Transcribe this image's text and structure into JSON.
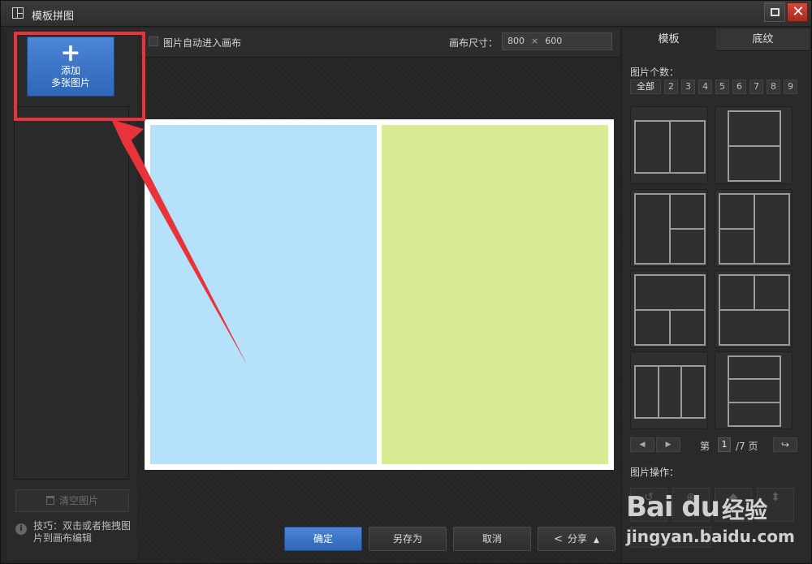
{
  "window": {
    "title": "模板拼图"
  },
  "left": {
    "add_plus": "+",
    "add_line1": "添加",
    "add_line2": "多张图片",
    "clear_label": "清空图片",
    "tip_text": "技巧：双击或者拖拽图片到画布编辑",
    "tip_icon": "i"
  },
  "toolbar": {
    "auto_label": "图片自动进入画布",
    "size_label": "画布尺寸：",
    "width": "800",
    "times": "×",
    "height": "600"
  },
  "buttons": {
    "ok": "确定",
    "save_as": "另存为",
    "cancel": "取消",
    "share": "分享"
  },
  "right": {
    "tab_template": "模板",
    "tab_texture": "底纹",
    "count_label": "图片个数：",
    "counts": [
      "全部",
      "2",
      "3",
      "4",
      "5",
      "6",
      "7",
      "8",
      "9"
    ],
    "page_prefix": "第",
    "page_current": "1",
    "page_suffix": "/7 页",
    "ops_label": "图片操作："
  },
  "watermark": {
    "logo": "Bai du",
    "cn": "经验",
    "url": "jingyan.baidu.com"
  },
  "colors": {
    "accent": "#2f66b8",
    "highlight": "#e8333a",
    "cell_left": "#b5e1fb",
    "cell_right": "#d9ec93"
  }
}
